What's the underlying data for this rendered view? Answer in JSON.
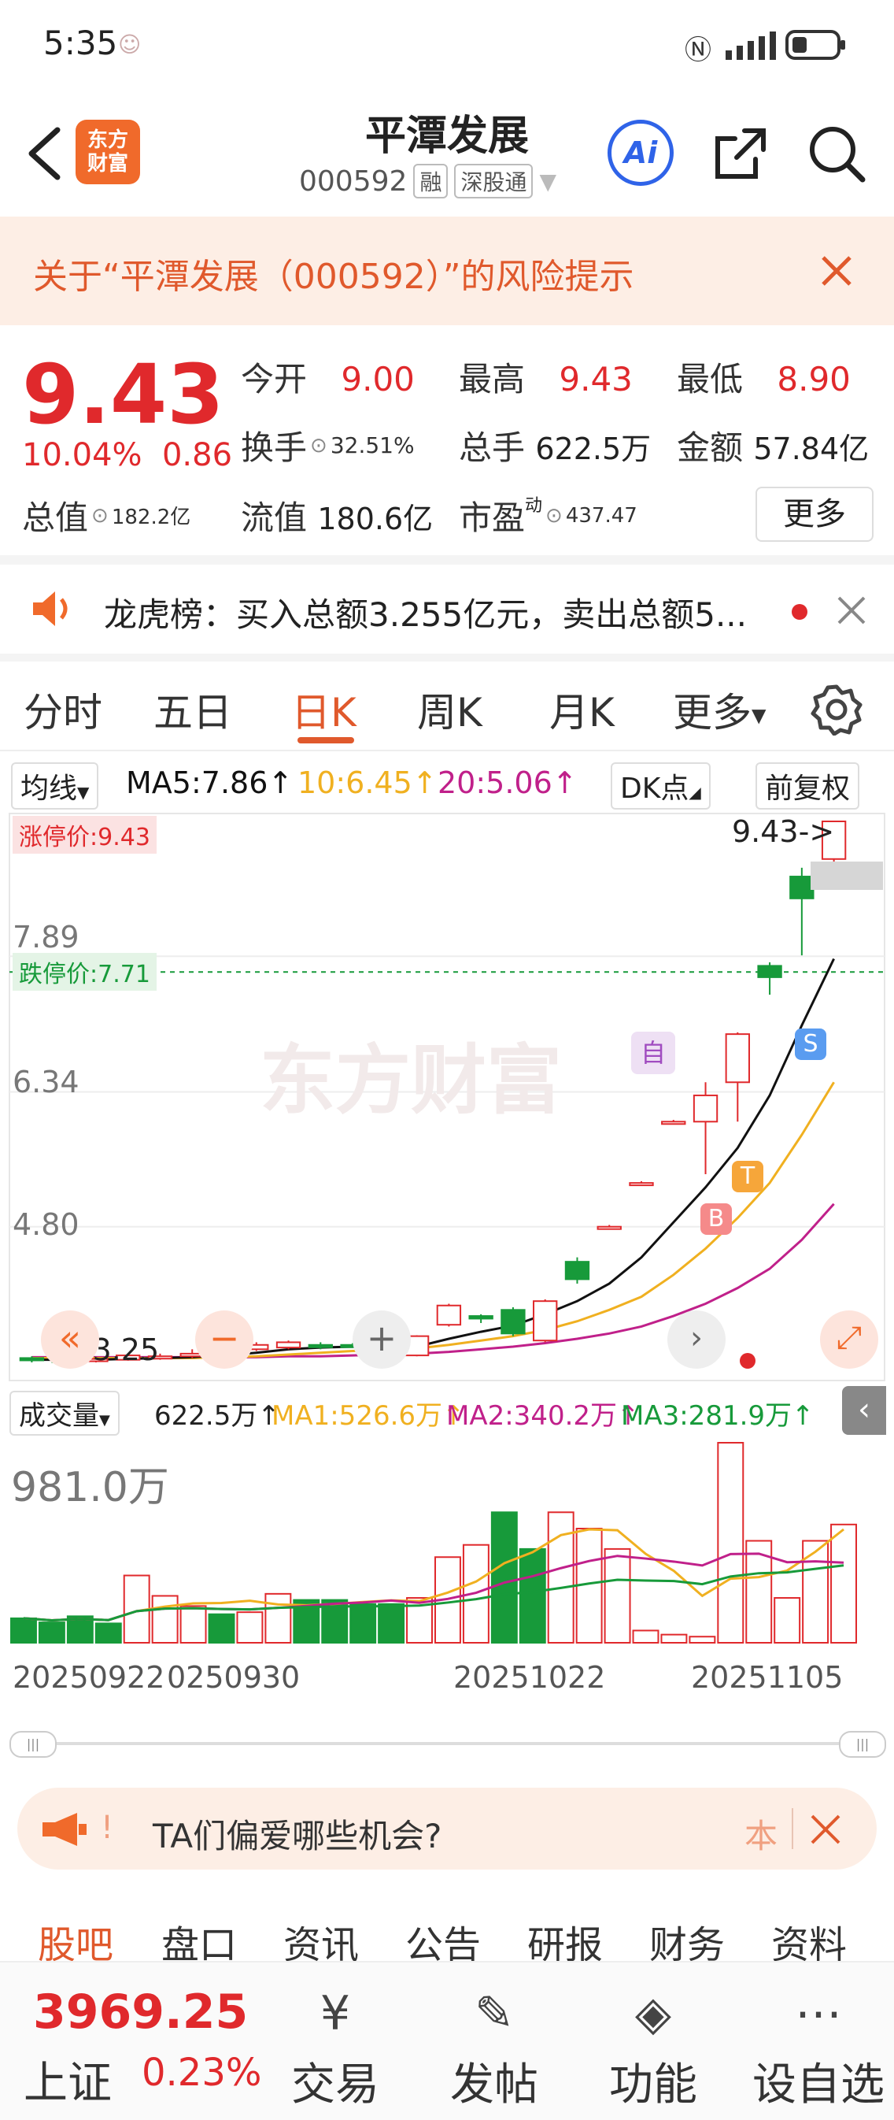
{
  "status_bar": {
    "time": "5:35"
  },
  "header": {
    "title": "平潭发展",
    "code": "000592",
    "tag1": "融",
    "tag2": "深股通",
    "logo_line1": "东方",
    "logo_line2": "财富",
    "ai_label": "Ai"
  },
  "warning": {
    "text": "关于“平潭发展（000592）”的风险提示"
  },
  "quote": {
    "price": "9.43",
    "change_pct": "10.04%",
    "change_abs": "0.86",
    "open_label": "今开",
    "open": "9.00",
    "high_label": "最高",
    "high": "9.43",
    "low_label": "最低",
    "low": "8.90",
    "turnover_label": "换手",
    "turnover": "32.51%",
    "volume_label": "总手",
    "volume": "622.5万",
    "amount_label": "金额",
    "amount": "57.84亿",
    "mcap_label": "总值",
    "mcap": "182.2亿",
    "float_label": "流值",
    "float": "180.6亿",
    "pe_label": "市盈",
    "pe_sup": "动",
    "pe": "437.47",
    "more": "更多"
  },
  "notice": {
    "text": "龙虎榜：买入总额3.255亿元，卖出总额5..."
  },
  "tabs": [
    "分时",
    "五日",
    "日K",
    "周K",
    "月K",
    "更多"
  ],
  "active_tab": 2,
  "ma_header": {
    "select": "均线",
    "ma5": "MA5:7.86↑",
    "ma10": "10:6.45↑",
    "ma20": "20:5.06↑",
    "dk": "DK点",
    "adj": "前复权"
  },
  "price_axis": {
    "top": "9.43",
    "l1": "7.89",
    "l2": "6.34",
    "l3": "4.80",
    "low": "3.25"
  },
  "limit_up": "涨停价:9.43",
  "limit_down": "跌停价:7.71",
  "last_marker": "9.43->",
  "low_marker": "<-3.25",
  "watermark": "东方财富",
  "signals": {
    "zi": "自",
    "b": "B",
    "t": "T",
    "s": "S"
  },
  "volume_header": {
    "select": "成交量",
    "vol": "622.5万↑",
    "ma1": "MA1:526.6万↑",
    "ma2": "MA2:340.2万↑",
    "ma3": "MA3:281.9万↑"
  },
  "volume_axis_top": "981.0万",
  "dates": [
    "20250922",
    "0250930",
    "20251022",
    "20251105"
  ],
  "promo": {
    "text": "TA们偏爱哪些机会?",
    "side": "本"
  },
  "sub_tabs": [
    "股吧",
    "盘口",
    "资讯",
    "公告",
    "研报",
    "财务",
    "资料"
  ],
  "bottom_bar": {
    "index_value": "3969.25",
    "index_name": "上证",
    "index_pct": "0.23%",
    "items": [
      "交易",
      "发帖",
      "功能",
      "设自选"
    ]
  },
  "colors": {
    "up": "#e0292c",
    "down": "#179a3a",
    "ma5": "#111111",
    "ma10": "#f0b020",
    "ma20": "#c0208a",
    "accent": "#e0592c"
  },
  "chart_data": {
    "type": "candlestick",
    "ylim": [
      3.25,
      9.43
    ],
    "candles": [
      {
        "o": 3.3,
        "c": 3.28,
        "h": 3.32,
        "l": 3.25
      },
      {
        "o": 3.28,
        "c": 3.27,
        "h": 3.3,
        "l": 3.25
      },
      {
        "o": 3.27,
        "c": 3.29,
        "h": 3.3,
        "l": 3.25
      },
      {
        "o": 3.28,
        "c": 3.33,
        "h": 3.35,
        "l": 3.27
      },
      {
        "o": 3.3,
        "c": 3.32,
        "h": 3.35,
        "l": 3.28
      },
      {
        "o": 3.32,
        "c": 3.35,
        "h": 3.4,
        "l": 3.3
      },
      {
        "o": 3.35,
        "c": 3.38,
        "h": 3.42,
        "l": 3.33
      },
      {
        "o": 3.4,
        "c": 3.45,
        "h": 3.48,
        "l": 3.38
      },
      {
        "o": 3.42,
        "c": 3.48,
        "h": 3.5,
        "l": 3.4
      },
      {
        "o": 3.45,
        "c": 3.44,
        "h": 3.48,
        "l": 3.4
      },
      {
        "o": 3.45,
        "c": 3.44,
        "h": 3.47,
        "l": 3.42
      },
      {
        "o": 3.38,
        "c": 3.3,
        "h": 3.4,
        "l": 3.28
      },
      {
        "o": 3.33,
        "c": 3.55,
        "h": 3.56,
        "l": 3.32
      },
      {
        "o": 3.68,
        "c": 3.9,
        "h": 3.92,
        "l": 3.66
      },
      {
        "o": 3.78,
        "c": 3.75,
        "h": 3.8,
        "l": 3.7
      },
      {
        "o": 3.85,
        "c": 3.58,
        "h": 3.88,
        "l": 3.55
      },
      {
        "o": 3.5,
        "c": 3.95,
        "h": 3.97,
        "l": 3.48
      },
      {
        "o": 4.4,
        "c": 4.2,
        "h": 4.45,
        "l": 4.15
      },
      {
        "o": 4.8,
        "c": 4.8,
        "h": 4.82,
        "l": 4.78
      },
      {
        "o": 5.3,
        "c": 5.3,
        "h": 5.32,
        "l": 5.28
      },
      {
        "o": 6.0,
        "c": 6.0,
        "h": 6.02,
        "l": 5.98
      },
      {
        "o": 6.0,
        "c": 6.3,
        "h": 6.45,
        "l": 5.4
      },
      {
        "o": 6.45,
        "c": 7.0,
        "h": 7.02,
        "l": 6.0
      },
      {
        "o": 7.78,
        "c": 7.65,
        "h": 7.82,
        "l": 7.45
      },
      {
        "o": 8.8,
        "c": 8.55,
        "h": 8.9,
        "l": 7.9
      },
      {
        "o": 9.0,
        "c": 9.43,
        "h": 9.43,
        "l": 8.9
      }
    ],
    "ma5": [
      3.28,
      3.28,
      3.28,
      3.29,
      3.3,
      3.31,
      3.33,
      3.36,
      3.4,
      3.42,
      3.43,
      3.42,
      3.43,
      3.52,
      3.6,
      3.67,
      3.8,
      3.95,
      4.15,
      4.45,
      4.85,
      5.25,
      5.7,
      6.3,
      7.1,
      7.86
    ],
    "ma10": [
      3.3,
      3.3,
      3.3,
      3.3,
      3.3,
      3.3,
      3.31,
      3.32,
      3.34,
      3.36,
      3.38,
      3.39,
      3.41,
      3.45,
      3.5,
      3.55,
      3.62,
      3.72,
      3.85,
      4.0,
      4.25,
      4.55,
      4.9,
      5.3,
      5.85,
      6.45
    ],
    "ma20": [
      3.31,
      3.31,
      3.31,
      3.31,
      3.31,
      3.31,
      3.31,
      3.31,
      3.32,
      3.32,
      3.33,
      3.34,
      3.35,
      3.37,
      3.4,
      3.43,
      3.47,
      3.52,
      3.58,
      3.66,
      3.78,
      3.92,
      4.1,
      4.32,
      4.65,
      5.06
    ],
    "volume_top": 981.0,
    "volumes": [
      120,
      100,
      130,
      95,
      330,
      230,
      180,
      140,
      150,
      240,
      210,
      210,
      190,
      190,
      220,
      420,
      480,
      640,
      460,
      640,
      560,
      460,
      60,
      40,
      30,
      981,
      500,
      220,
      500,
      580
    ]
  }
}
